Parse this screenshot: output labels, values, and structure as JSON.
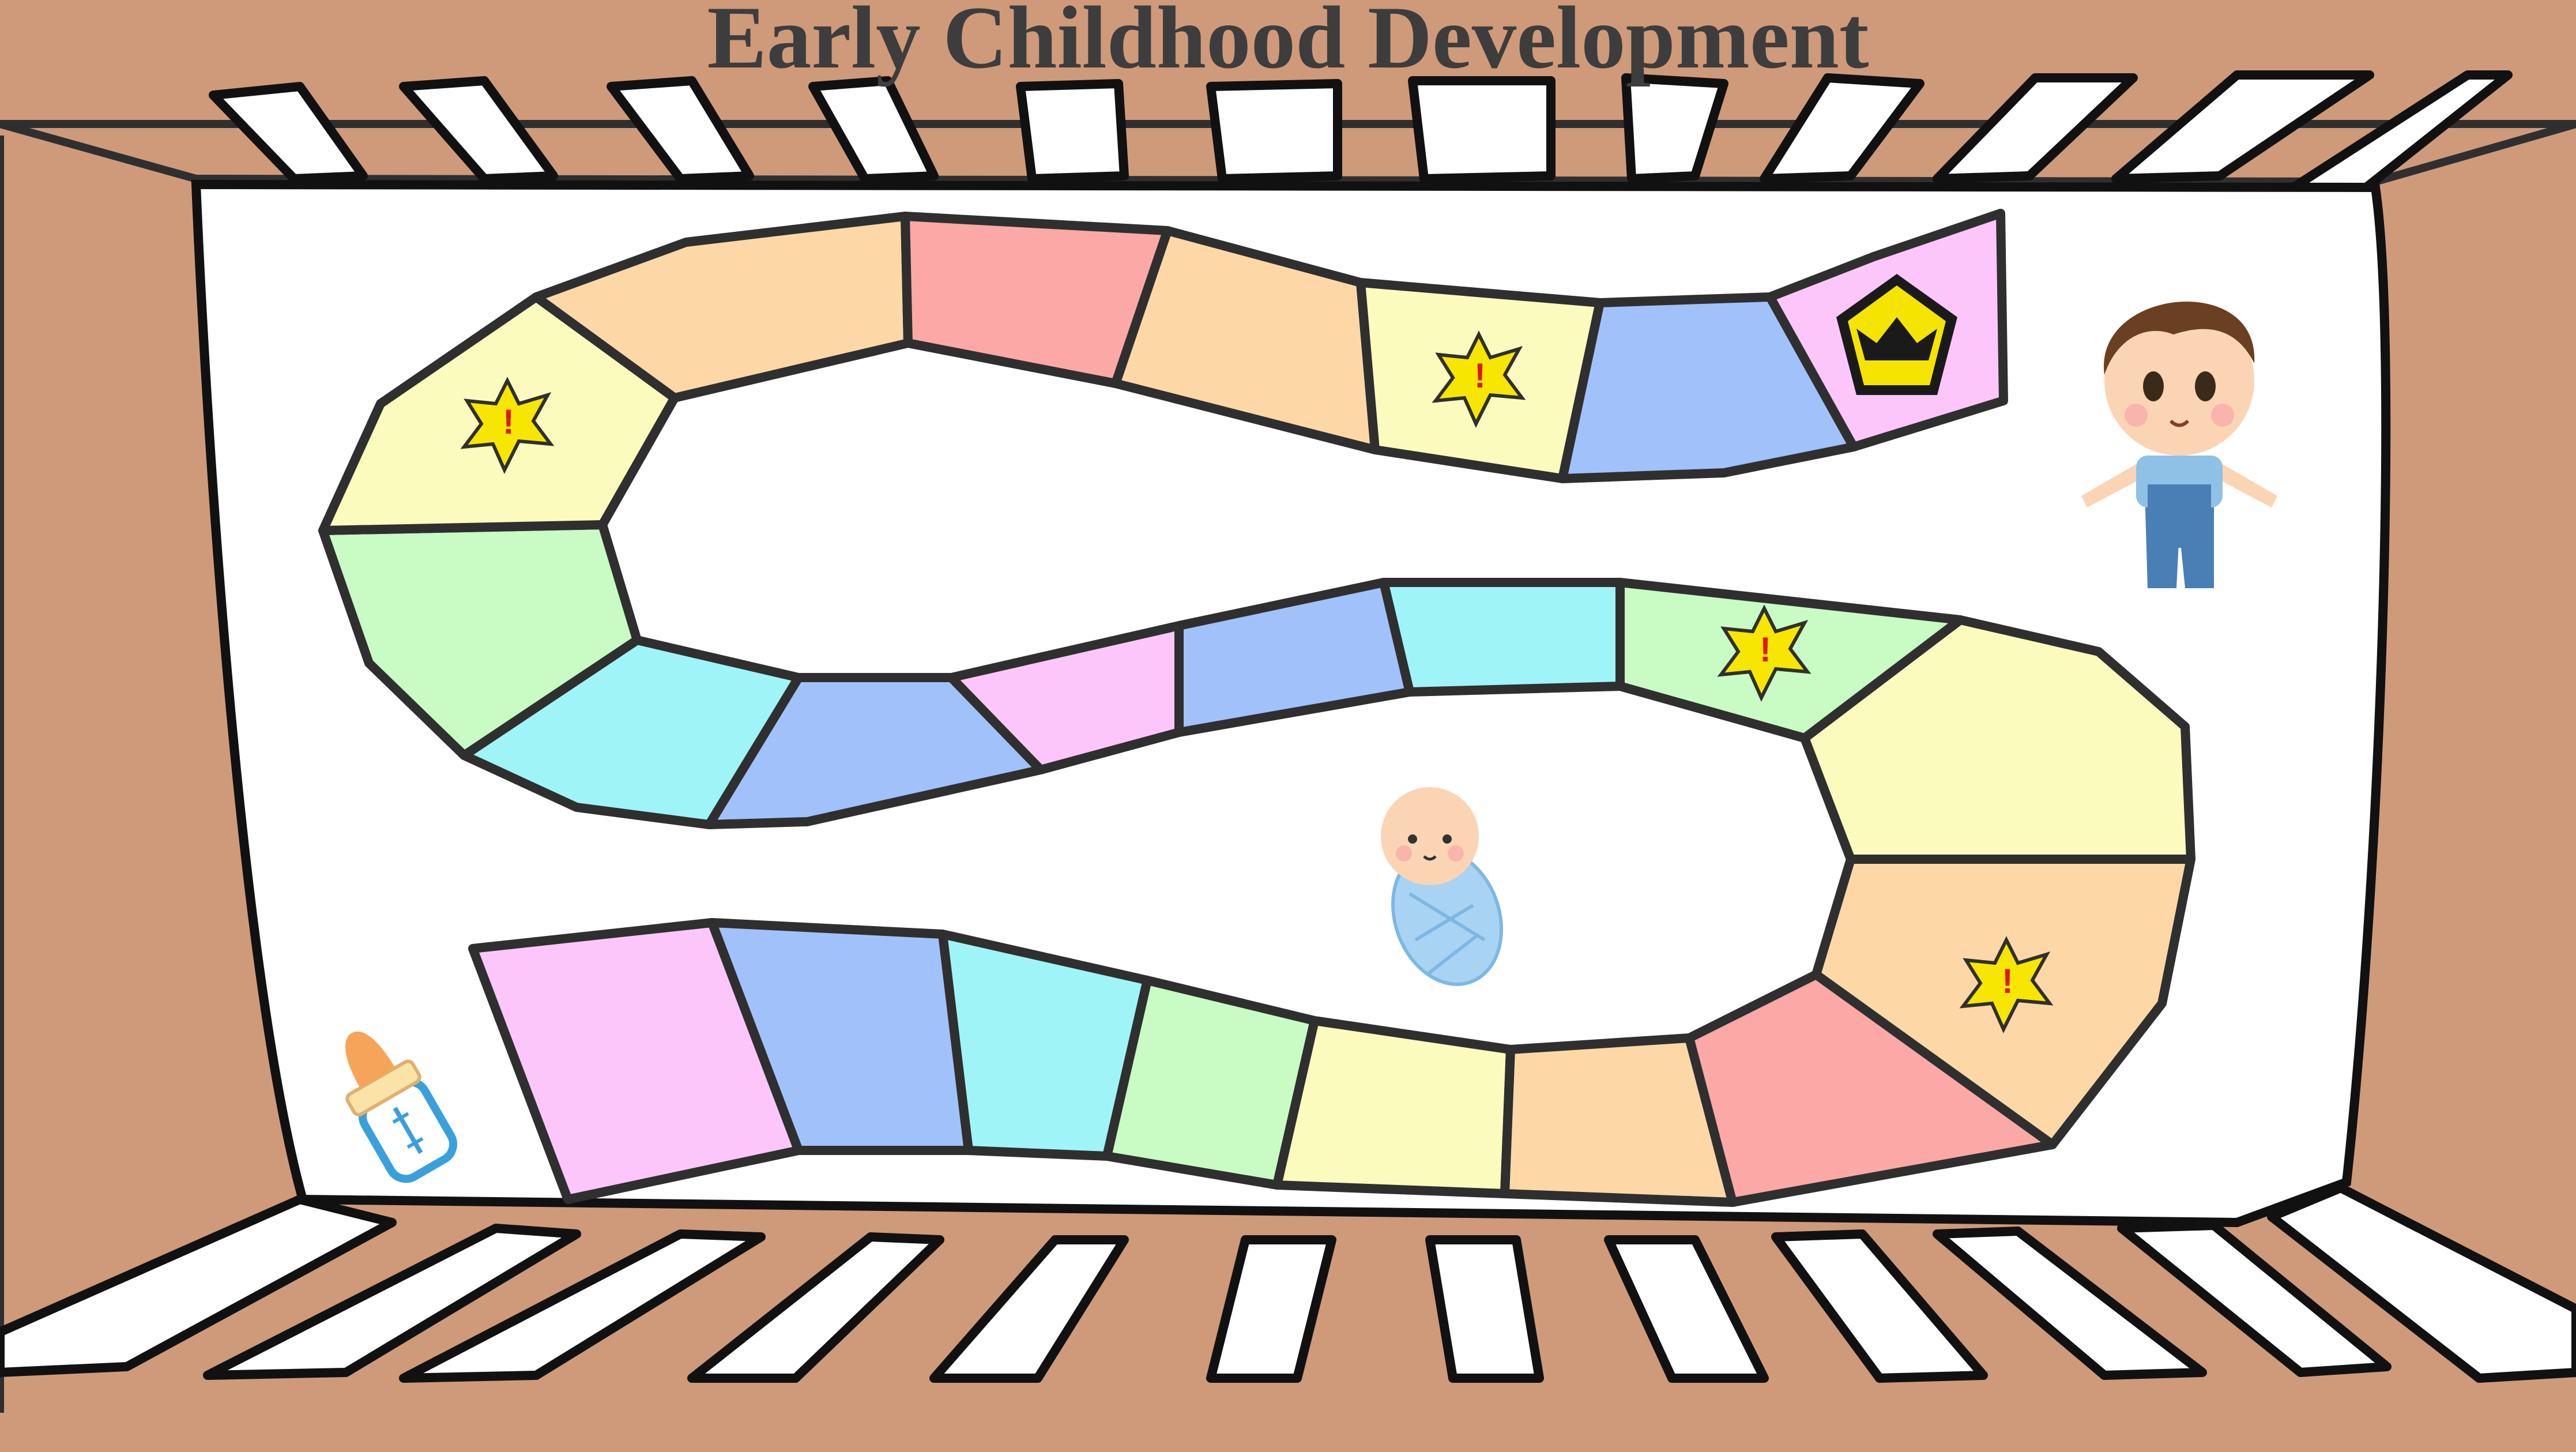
{
  "title": "Early Childhood Development",
  "colors": {
    "crib": "#cf9a7a",
    "mattress": "#ffffff",
    "outline": "#2f2f2f",
    "title": "#3d3d3d",
    "star": "#f7e600",
    "crown_badge": "#f5e300"
  },
  "board": {
    "path_spaces": [
      {
        "index": 1,
        "color": "#fcc6fb"
      },
      {
        "index": 2,
        "color": "#a1c1fb"
      },
      {
        "index": 3,
        "color": "#9ff4f8"
      },
      {
        "index": 4,
        "color": "#c9fbc4"
      },
      {
        "index": 5,
        "color": "#fbfbbd"
      },
      {
        "index": 6,
        "color": "#fdd8a6"
      },
      {
        "index": 7,
        "color": "#fba8a6"
      },
      {
        "index": 8,
        "color": "#fdd8a6",
        "marker": "star-icon"
      },
      {
        "index": 9,
        "color": "#fbfbbd"
      },
      {
        "index": 10,
        "color": "#c9fbc4",
        "marker": "star-icon"
      },
      {
        "index": 11,
        "color": "#9ff4f8"
      },
      {
        "index": 12,
        "color": "#a1c1fb"
      },
      {
        "index": 13,
        "color": "#fcc6fb"
      },
      {
        "index": 14,
        "color": "#a1c1fb"
      },
      {
        "index": 15,
        "color": "#9ff4f8"
      },
      {
        "index": 16,
        "color": "#c9fbc4"
      },
      {
        "index": 17,
        "color": "#fbfbbd",
        "marker": "star-icon"
      },
      {
        "index": 18,
        "color": "#fdd8a6"
      },
      {
        "index": 19,
        "color": "#fba8a6"
      },
      {
        "index": 20,
        "color": "#fdd8a6"
      },
      {
        "index": 21,
        "color": "#fbfbbd",
        "marker": "star-icon"
      },
      {
        "index": 22,
        "color": "#a1c1fb"
      },
      {
        "index": 23,
        "color": "#fcc6fb",
        "marker": "crown-icon"
      }
    ],
    "start_icon": "baby-bottle-icon",
    "center_icon": "swaddled-baby-icon",
    "finish_icon": "toddler-boy-icon"
  }
}
